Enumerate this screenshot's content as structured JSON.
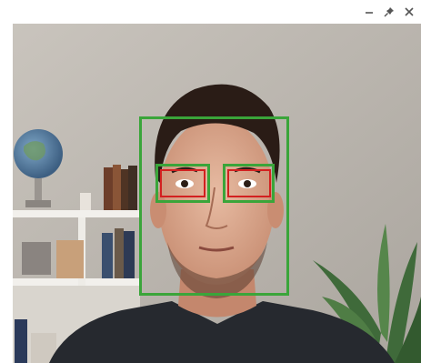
{
  "window": {
    "controls": [
      {
        "name": "minimize",
        "icon": "minimize-icon"
      },
      {
        "name": "pin",
        "icon": "pin-icon"
      },
      {
        "name": "close",
        "icon": "close-icon"
      }
    ]
  },
  "detection": {
    "face_color": "#3aa53a",
    "eye_color": "#d32020",
    "face_count": 1,
    "eye_count": 2
  }
}
